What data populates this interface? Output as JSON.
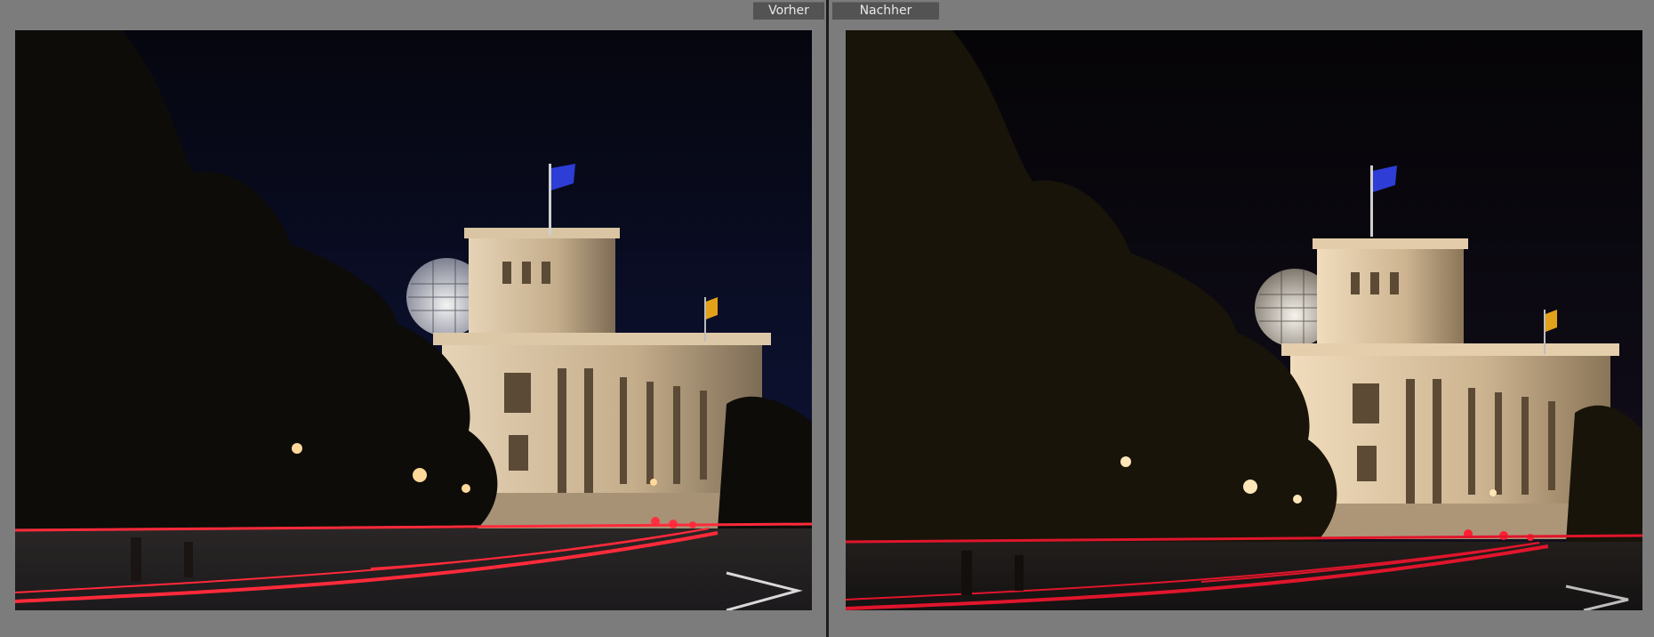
{
  "compare_view": {
    "before_label": "Vorher",
    "after_label": "Nachher"
  },
  "panes": [
    {
      "id": "before",
      "sky_color": "#090c1f",
      "tree_color": "#0d0c09",
      "light_trail_color": "#ff2a3a"
    },
    {
      "id": "after",
      "sky_color": "#0a0810",
      "tree_color": "#181409",
      "light_trail_color": "#e0152c"
    }
  ]
}
